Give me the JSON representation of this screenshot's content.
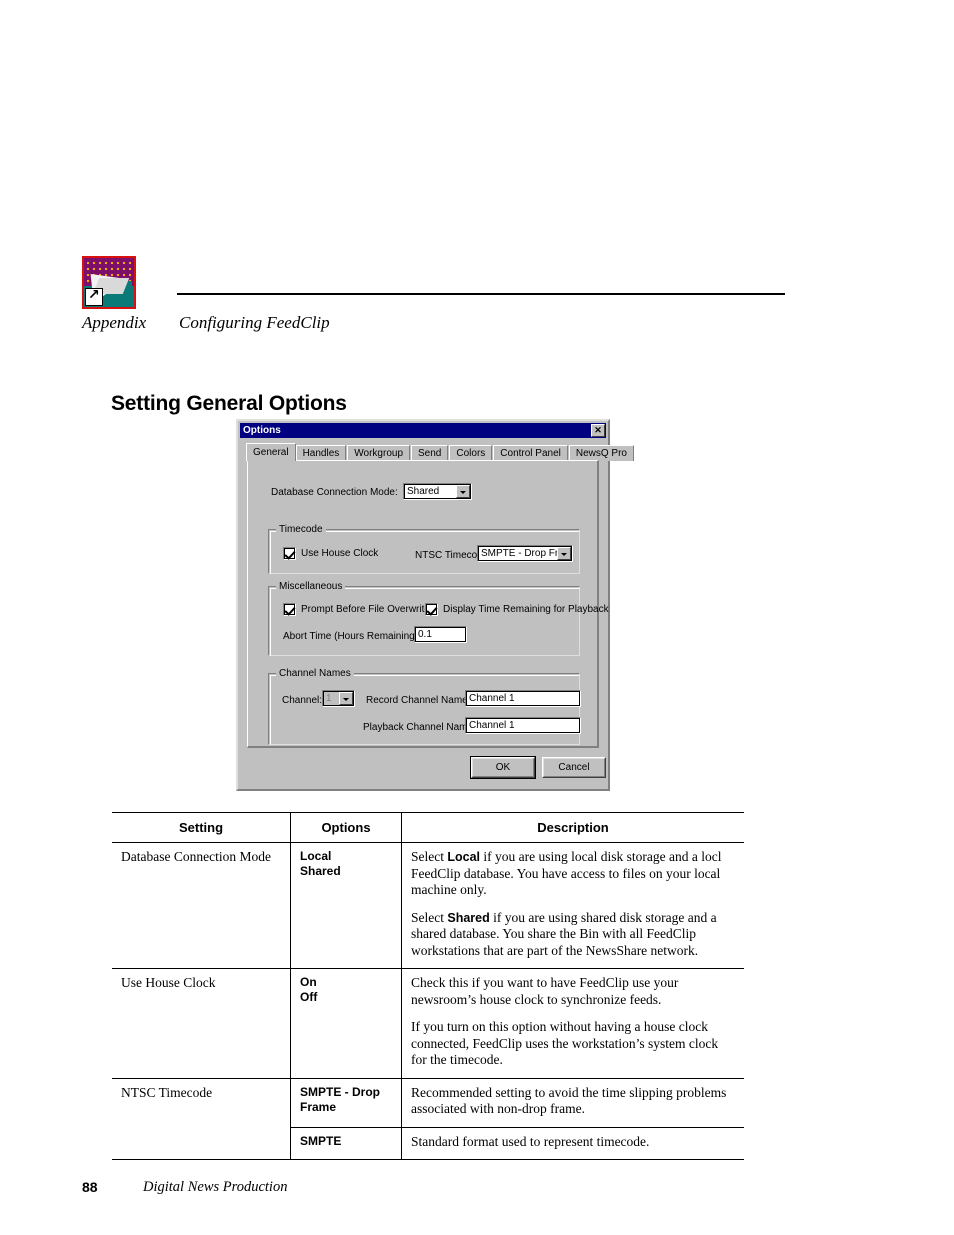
{
  "page": {
    "appendix_label": "Appendix",
    "appendix_title": "Configuring FeedClip",
    "section_title": "Setting General Options",
    "page_number": "88",
    "footer_title": "Digital News Production"
  },
  "dialog": {
    "title": "Options",
    "close_glyph": "✕",
    "titlebar_color": "#000080",
    "face_color": "#c0c0c0",
    "tabs": [
      {
        "label": "General",
        "active": true
      },
      {
        "label": "Handles",
        "active": false
      },
      {
        "label": "Workgroup",
        "active": false
      },
      {
        "label": "Send",
        "active": false
      },
      {
        "label": "Colors",
        "active": false
      },
      {
        "label": "Control Panel",
        "active": false
      },
      {
        "label": "NewsQ Pro",
        "active": false
      }
    ],
    "database_connection_mode": {
      "label": "Database Connection Mode:",
      "value": "Shared"
    },
    "timecode_group": {
      "title": "Timecode",
      "use_house_clock": {
        "label": "Use House Clock",
        "checked": true
      },
      "ntsc_timecode": {
        "label": "NTSC Timecode:",
        "value": "SMPTE - Drop Frame"
      }
    },
    "miscellaneous_group": {
      "title": "Miscellaneous",
      "prompt_before_overwrite": {
        "label": "Prompt Before File Overwrite",
        "checked": true
      },
      "display_time_remaining": {
        "label": "Display Time Remaining for Playback",
        "checked": true
      },
      "abort_time": {
        "label": "Abort Time (Hours Remaining):",
        "value": "0.1"
      }
    },
    "channel_names_group": {
      "title": "Channel Names",
      "channel": {
        "label": "Channel:",
        "value": "1"
      },
      "record_channel_name": {
        "label": "Record Channel Name:",
        "value": "Channel 1"
      },
      "playback_channel_name": {
        "label": "Playback Channel Name:",
        "value": "Channel 1"
      }
    },
    "buttons": {
      "ok": "OK",
      "cancel": "Cancel"
    }
  },
  "table": {
    "headers": {
      "setting": "Setting",
      "options": "Options",
      "description": "Description"
    },
    "rows": [
      {
        "setting": "Database Connection Mode",
        "options": "Local\nShared",
        "description_p1_a": "Select ",
        "description_p1_b": "Local",
        "description_p1_c": " if you are using local disk storage and a locl FeedClip database. You have access to files on your local machine only.",
        "description_p2_a": "Select ",
        "description_p2_b": "Shared",
        "description_p2_c": " if you are using shared disk storage and a shared database. You share the Bin with all FeedClip workstations that are part of the NewsShare network."
      },
      {
        "setting": "Use House Clock",
        "options": "On\nOff",
        "description_p1": "Check this if you want to have FeedClip use your newsroom’s house clock to synchronize feeds.",
        "description_p2": "If you turn on this option without having a house clock connected, FeedClip uses the workstation’s system clock for the timecode."
      },
      {
        "setting": "NTSC Timecode",
        "options": "SMPTE - Drop Frame",
        "description_p1": "Recommended setting to avoid the time slipping problems associated with non-drop frame."
      },
      {
        "setting": "",
        "options": "SMPTE",
        "description_p1": "Standard format used to represent timecode."
      }
    ]
  }
}
